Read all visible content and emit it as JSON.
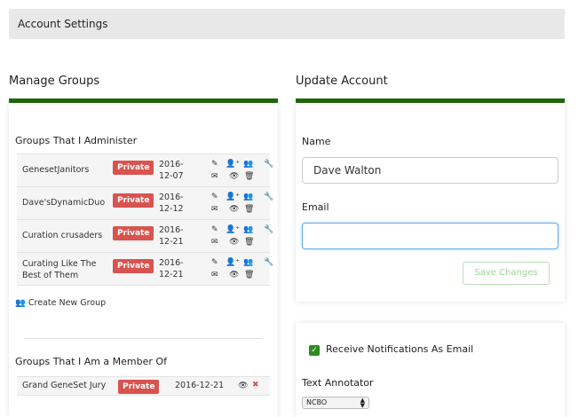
{
  "header": {
    "title": "Account Settings"
  },
  "manage_groups": {
    "title": "Manage Groups",
    "administer_title": "Groups That I Administer",
    "administer_rows": [
      {
        "name": "GenesetJanitors",
        "badge": "Private",
        "date_line1": "2016-",
        "date_line2": "12-07"
      },
      {
        "name": "Dave'sDynamicDuo",
        "badge": "Private",
        "date_line1": "2016-",
        "date_line2": "12-12"
      },
      {
        "name": "Curation crusaders",
        "badge": "Private",
        "date_line1": "2016-",
        "date_line2": "12-21"
      },
      {
        "name_line1": "Curating Like The",
        "name_line2": "Best of Them",
        "badge": "Private",
        "date_line1": "2016-",
        "date_line2": "12-21"
      }
    ],
    "create_new_group": "Create New Group",
    "member_title": "Groups That I Am a Member Of",
    "member_rows": [
      {
        "name": "Grand GeneSet Jury",
        "badge": "Private",
        "date": "2016-12-21"
      }
    ]
  },
  "update_account": {
    "title": "Update Account",
    "name_label": "Name",
    "name_value": "Dave Walton",
    "email_label": "Email",
    "email_value": "",
    "save_label": "Save Changes",
    "notifications_label": "Receive Notifications As Email",
    "text_annotator_label": "Text Annotator",
    "text_annotator_value": "NCBO"
  },
  "colors": {
    "accent_green": "#1c6b0a",
    "badge_red": "#d9534f",
    "checkbox_green": "#2e8b1e"
  },
  "icons": [
    "edit-icon",
    "add-user-icon",
    "users-icon",
    "wrench-icon",
    "envelope-icon",
    "eye-icon",
    "trash-icon",
    "close-icon"
  ]
}
